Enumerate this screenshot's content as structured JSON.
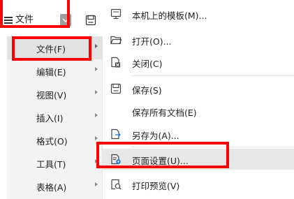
{
  "toolbar": {
    "file_label": "文件",
    "menu_icon": "hamburger-menu-icon",
    "dropdown_icon": "chevron-down-icon",
    "save_icon": "save-icon"
  },
  "left_menu": {
    "items": [
      {
        "label": "文件(F)",
        "active": true
      },
      {
        "label": "编辑(E)"
      },
      {
        "label": "视图(V)"
      },
      {
        "label": "插入(I)"
      },
      {
        "label": "格式(O)"
      },
      {
        "label": "工具(T)"
      },
      {
        "label": "表格(A)"
      }
    ]
  },
  "right_menu": {
    "items": [
      {
        "label": "本机上的模板(M)...",
        "icon": "template-icon"
      },
      {
        "label": "打开(O)...",
        "icon": "folder-open-icon"
      },
      {
        "label": "关闭(C)",
        "icon": "close-document-icon"
      },
      {
        "label": "保存(S)",
        "icon": "save-icon"
      },
      {
        "label": "保存所有文档(E)",
        "icon": ""
      },
      {
        "label": "另存为(A)...",
        "icon": "save-as-icon"
      },
      {
        "label": "页面设置(U)...",
        "icon": "page-setup-icon",
        "highlighted": true
      },
      {
        "label": "打印预览(V)",
        "icon": "print-preview-icon"
      }
    ]
  },
  "colors": {
    "highlight_box": "#ff0000",
    "menu_hover": "#e8e8e8",
    "left_menu_bg": "#f3f3f3",
    "dropdown_bg": "#9d9d9d"
  }
}
